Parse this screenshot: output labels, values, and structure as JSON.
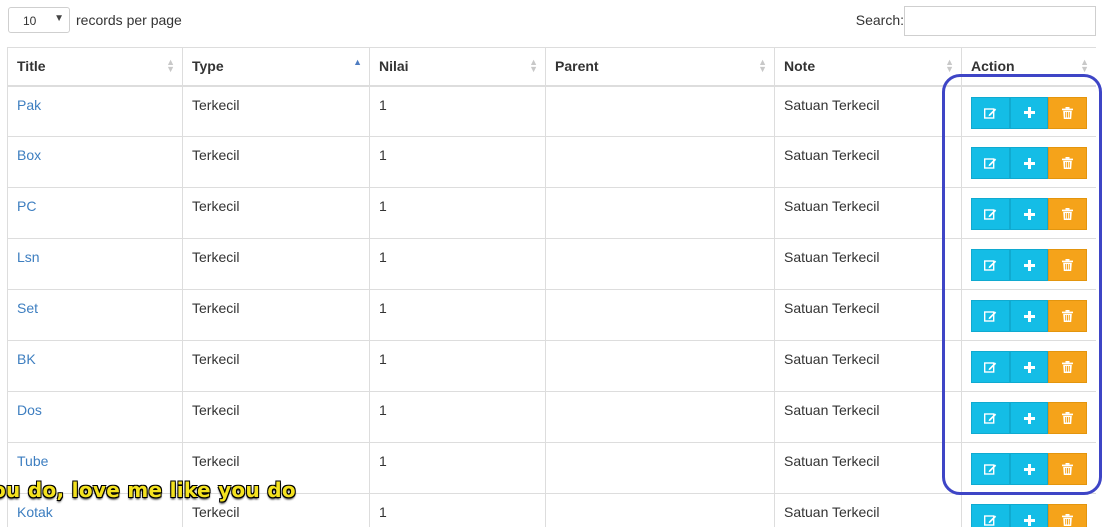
{
  "controls": {
    "length_value": "10",
    "length_label": "records per page",
    "search_label": "Search:",
    "search_value": ""
  },
  "table": {
    "headers": [
      "Title",
      "Type",
      "Nilai",
      "Parent",
      "Note",
      "Action"
    ],
    "sorted_column": "Type",
    "rows": [
      {
        "title": "Pak",
        "type": "Terkecil",
        "nilai": "1",
        "parent": "",
        "note": "Satuan Terkecil"
      },
      {
        "title": "Box",
        "type": "Terkecil",
        "nilai": "1",
        "parent": "",
        "note": "Satuan Terkecil"
      },
      {
        "title": "PC",
        "type": "Terkecil",
        "nilai": "1",
        "parent": "",
        "note": "Satuan Terkecil"
      },
      {
        "title": "Lsn",
        "type": "Terkecil",
        "nilai": "1",
        "parent": "",
        "note": "Satuan Terkecil"
      },
      {
        "title": "Set",
        "type": "Terkecil",
        "nilai": "1",
        "parent": "",
        "note": "Satuan Terkecil"
      },
      {
        "title": "BK",
        "type": "Terkecil",
        "nilai": "1",
        "parent": "",
        "note": "Satuan Terkecil"
      },
      {
        "title": "Dos",
        "type": "Terkecil",
        "nilai": "1",
        "parent": "",
        "note": "Satuan Terkecil"
      },
      {
        "title": "Tube",
        "type": "Terkecil",
        "nilai": "1",
        "parent": "",
        "note": "Satuan Terkecil"
      },
      {
        "title": "Kotak",
        "type": "Terkecil",
        "nilai": "1",
        "parent": "",
        "note": "Satuan Terkecil"
      }
    ],
    "action_icons": [
      "edit-icon",
      "plus-icon",
      "trash-icon"
    ]
  },
  "overlay": {
    "subtitle": "ou do, love me like you do"
  },
  "colors": {
    "link": "#3d7ec0",
    "info_button": "#14bde6",
    "warning_button": "#f5a31a",
    "highlight_border": "#3e45c6",
    "subtitle": "#f4e21f"
  }
}
